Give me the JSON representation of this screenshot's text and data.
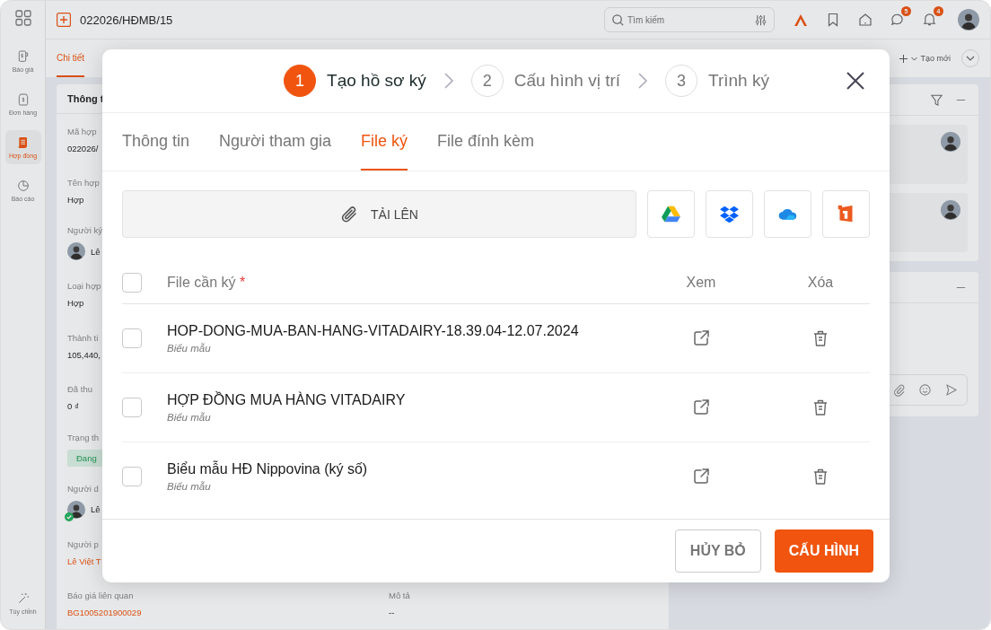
{
  "sidebar": {
    "items": [
      {
        "label": "Báo giá",
        "kind": "quote",
        "selected": false
      },
      {
        "label": "Đơn hàng",
        "kind": "order",
        "selected": false
      },
      {
        "label": "Hợp đồng",
        "kind": "contract",
        "selected": true
      },
      {
        "label": "Báo cáo",
        "kind": "report",
        "selected": false
      }
    ],
    "footer": "Tùy chỉnh"
  },
  "header": {
    "title": "022026/HĐMB/15",
    "search": {
      "placeholder": "Tìm kiếm"
    },
    "badges": [
      {
        "kind": "chat",
        "count": "5"
      },
      {
        "kind": "bell",
        "count": "4"
      }
    ]
  },
  "page_tabs": [
    {
      "label": "Chi tiết",
      "selected": true
    }
  ],
  "create_button": "Tạo mới",
  "info_card": {
    "title": "Thông t",
    "fields": [
      {
        "label": "Mã hợp",
        "value": "022026/",
        "kind": "text"
      },
      {
        "label": "Tên hợp",
        "value": "Hợp",
        "kind": "text"
      },
      {
        "label": "Người ký",
        "value": "Lê",
        "kind": "person",
        "verified": false
      },
      {
        "label": "Loại hợp",
        "value": "Hợp",
        "kind": "text"
      },
      {
        "label": "Thành ti",
        "value": "105,440,",
        "kind": "text"
      },
      {
        "label": "Đã thu",
        "value": "0 ₫",
        "kind": "text"
      },
      {
        "label": "Trạng th",
        "value": "Đang",
        "kind": "status"
      },
      {
        "label": "Người d",
        "value": "Lê",
        "kind": "person",
        "verified": true
      },
      {
        "label": "Người p",
        "value": "Lê Việt T",
        "kind": "link"
      }
    ],
    "bottom_fields": [
      {
        "label": "Báo giá liên quan",
        "value": "BG1005201900029",
        "kind": "link"
      },
      {
        "label": "Mô tả",
        "value": "--",
        "kind": "text"
      }
    ]
  },
  "modal": {
    "steps": [
      {
        "number": "1",
        "label": "Tạo hồ sơ ký",
        "selected": true
      },
      {
        "number": "2",
        "label": "Cấu hình vị trí",
        "selected": false
      },
      {
        "number": "3",
        "label": "Trình ký",
        "selected": false
      }
    ],
    "tabs": [
      {
        "label": "Thông tin",
        "selected": false
      },
      {
        "label": "Người tham gia",
        "selected": false
      },
      {
        "label": "File ký",
        "selected": true
      },
      {
        "label": "File đính kèm",
        "selected": false
      }
    ],
    "upload_label": "TẢI LÊN",
    "sources": [
      {
        "kind": "drive"
      },
      {
        "kind": "dropbox"
      },
      {
        "kind": "onedrive"
      },
      {
        "kind": "office"
      }
    ],
    "columns": {
      "file": "File cần ký",
      "required": "*",
      "view": "Xem",
      "delete": "Xóa"
    },
    "select_all": false,
    "files": [
      {
        "name": "HOP-DONG-MUA-BAN-HANG-VITADAIRY-18.39.04-12.07.2024",
        "type": "Biểu mẫu",
        "checked": false
      },
      {
        "name": "HỢP ĐỒNG MUA HÀNG VITADAIRY",
        "type": "Biểu mẫu",
        "checked": false
      },
      {
        "name": "Biểu mẫu HĐ Nippovina (ký số)",
        "type": "Biểu mẫu",
        "checked": false
      }
    ],
    "cancel": "HỦY BỎ",
    "confirm": "CẤU HÌNH"
  }
}
